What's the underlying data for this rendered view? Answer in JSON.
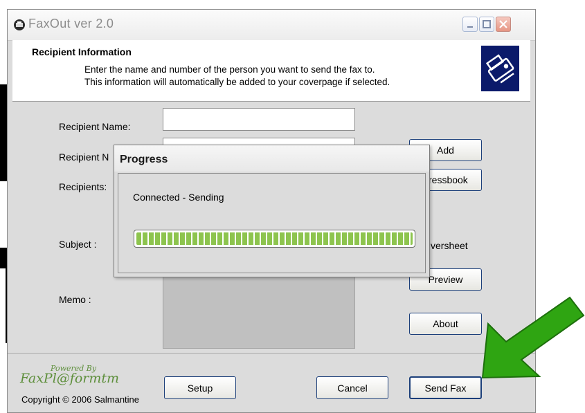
{
  "window": {
    "title": "FaxOut ver 2.0"
  },
  "header": {
    "title": "Recipient Information",
    "line1": "Enter the name and number of the person you want to send the fax to.",
    "line2": "This information will automatically be added to your coverpage if selected."
  },
  "form": {
    "recipient_name_label": "Recipient Name:",
    "recipient_number_label": "Recipient N",
    "recipients_label": "Recipients:",
    "subject_label": "Subject :",
    "memo_label": "Memo :",
    "recipient_name_value": "",
    "coversheet_label": "versheet"
  },
  "buttons": {
    "add": "Add",
    "addressbook": "dressbook",
    "preview": "Preview",
    "about": "About",
    "setup": "Setup",
    "cancel": "Cancel",
    "send_fax": "Send Fax"
  },
  "footer": {
    "powered_by": "Powered By",
    "brand": "FaxPl@formtm",
    "copyright": "Copyright © 2006 Salmantine"
  },
  "progress_dialog": {
    "title": "Progress",
    "status": "Connected - Sending",
    "progress_fraction": 1.0
  },
  "overlay": {
    "arrow_color": "#2fa512",
    "arrow_icon": "arrow-pointing-down-left"
  }
}
